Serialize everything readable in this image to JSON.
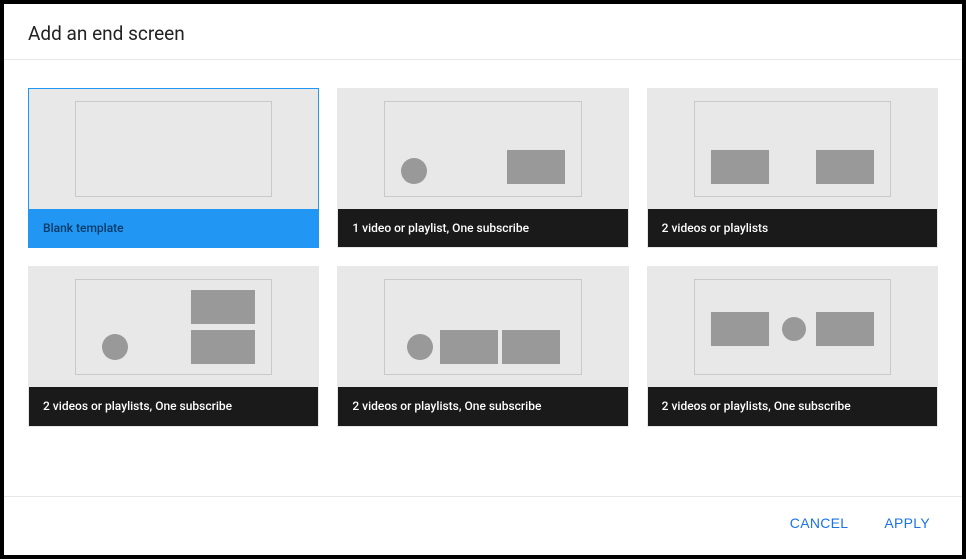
{
  "dialog": {
    "title": "Add an end screen"
  },
  "templates": [
    {
      "label": "Blank template",
      "selected": true
    },
    {
      "label": "1 video or playlist, One subscribe",
      "selected": false
    },
    {
      "label": "2 videos or playlists",
      "selected": false
    },
    {
      "label": "2 videos or playlists, One subscribe",
      "selected": false
    },
    {
      "label": "2 videos or playlists, One subscribe",
      "selected": false
    },
    {
      "label": "2 videos or playlists, One subscribe",
      "selected": false
    }
  ],
  "footer": {
    "cancel": "CANCEL",
    "apply": "APPLY"
  }
}
